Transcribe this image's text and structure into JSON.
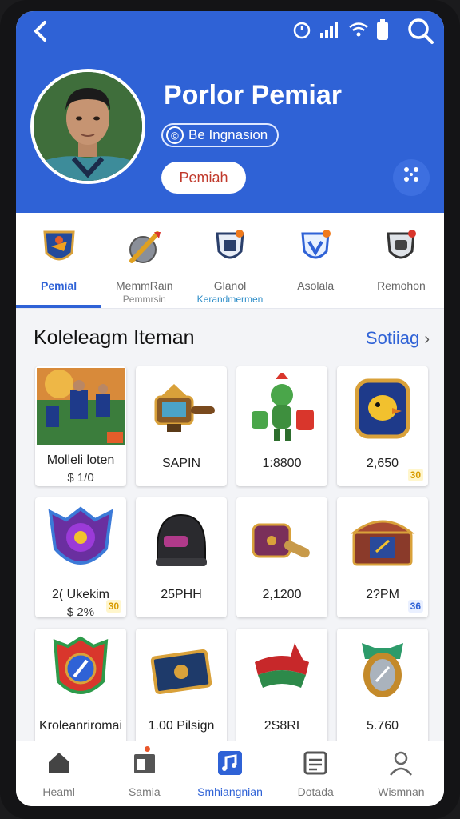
{
  "header": {
    "title": "Porlor Pemiar",
    "handle": "Be Ingnasion",
    "role_button": "Pemiah"
  },
  "icons": {
    "back": "chevron-left-icon",
    "search": "search-icon",
    "more": "grid-dots-icon"
  },
  "tabs": [
    {
      "label": "Pemial",
      "sub": "",
      "icon": "shield-crest-icon",
      "active": true
    },
    {
      "label": "MemmRain",
      "sub": "Pemmrsin",
      "icon": "sword-shield-icon"
    },
    {
      "label": "Glanol",
      "sub": "Kerandmermen",
      "icon": "castle-shield-icon"
    },
    {
      "label": "Asolala",
      "sub": "",
      "icon": "v-shield-icon"
    },
    {
      "label": "Remohon",
      "sub": "",
      "icon": "helmet-shield-icon"
    }
  ],
  "section": {
    "title": "Koleleagm Iteman",
    "see_all": "Sotiiag"
  },
  "items": [
    {
      "label": "Molleli loten",
      "sub": "$ 1/0",
      "badge": "",
      "icon": "player-card-icon"
    },
    {
      "label": "SAPIN",
      "sub": "",
      "badge": "",
      "icon": "lantern-icon"
    },
    {
      "label": "1:8800",
      "sub": "",
      "badge": "",
      "icon": "goblin-icon"
    },
    {
      "label": "2,650",
      "sub": "",
      "badge": "30",
      "icon": "bird-shield-icon"
    },
    {
      "label": "2( Ukekim",
      "sub": "$ 2%",
      "badge": "30",
      "icon": "purple-crest-icon"
    },
    {
      "label": "25PHH",
      "sub": "",
      "badge": "",
      "icon": "helmet-icon"
    },
    {
      "label": "2,1200",
      "sub": "",
      "badge": "",
      "icon": "treasure-cannon-icon"
    },
    {
      "label": "2?PM",
      "sub": "",
      "badge": "36",
      "icon": "treasure-chest-icon"
    },
    {
      "label": "Kroleanriromai",
      "sub": "",
      "badge": "",
      "icon": "emblem-icon"
    },
    {
      "label": "1.00 Pilsign",
      "sub": "",
      "badge": "",
      "icon": "scroll-icon"
    },
    {
      "label": "2S8RI",
      "sub": "",
      "badge": "",
      "icon": "scarf-icon"
    },
    {
      "label": "5.760",
      "sub": "",
      "badge": "",
      "icon": "mirror-icon"
    }
  ],
  "bottom_nav": [
    {
      "label": "Heaml",
      "icon": "home-icon"
    },
    {
      "label": "Samia",
      "icon": "calendar-icon"
    },
    {
      "label": "Smhiangnian",
      "icon": "music-square-icon",
      "active": true
    },
    {
      "label": "Dotada",
      "icon": "document-icon"
    },
    {
      "label": "Wismnan",
      "icon": "user-icon"
    }
  ],
  "colors": {
    "brand": "#2f62d6",
    "accent": "#c0392b"
  }
}
